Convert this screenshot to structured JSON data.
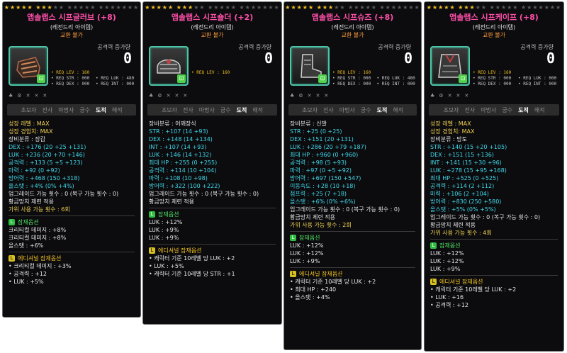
{
  "cards": [
    {
      "title": "앱솔랩스 시프글러브 (+8)",
      "rarity": "(레전드리 아이템)",
      "trade": "교환 불가",
      "stars_filled": 8,
      "stars_total": 22,
      "atk_label": "공격력 증가량",
      "atk_value": "0",
      "req_lev": "• REQ LEV : 160",
      "req_str": "• REQ STR : 000",
      "req_luk": "• REQ LUK : 480",
      "req_dex": "• REQ DEX : 000",
      "req_int": "• REQ INT : 000",
      "jobs": [
        "초보자",
        "전사",
        "마법사",
        "궁수",
        "도적",
        "해적"
      ],
      "active_job": "도적",
      "lines": [
        {
          "t": "성장 레벨 : MAX",
          "cls": "y"
        },
        {
          "t": "성장 경험치: MAX",
          "cls": "y"
        },
        {
          "t": "장비분류 : 장갑",
          "cls": "w"
        },
        {
          "t": "DEX : +176 (20 +25 +131)",
          "cls": "c"
        },
        {
          "t": "LUK : +236 (20 +70 +146)",
          "cls": "c"
        },
        {
          "t": "공격력 : +133 (5 +5 +123)",
          "cls": "c"
        },
        {
          "t": "마력 : +92 (0 +92)",
          "cls": "c"
        },
        {
          "t": "방어력 : +468 (150 +318)",
          "cls": "c"
        },
        {
          "t": "올스탯 : +4% (0% +4%)",
          "cls": "c"
        },
        {
          "t": "업그레이드 가능 횟수 : 0 (복구 가능 횟수 : 0)",
          "cls": "w"
        },
        {
          "t": "황금망치 제련 적용",
          "cls": "w"
        },
        {
          "t": "가위 사용 가능 횟수 : 6회",
          "cls": "y"
        }
      ],
      "potential_title": "잠재옵션",
      "potential": [
        "크리티컬 데미지 : +8%",
        "크리티컬 데미지 : +8%",
        "올스탯 : +6%"
      ],
      "additional_title": "에디셔널 잠재옵션",
      "additional": [
        "• 크리티컬 데미지 : +3%",
        "• 공격력 : +12",
        "• LUK : +5%"
      ]
    },
    {
      "title": "앱솔랩스 시프숄더 (+2)",
      "rarity": "(레전드리 아이템)",
      "trade": "교환 불가",
      "stars_filled": 8,
      "stars_total": 22,
      "atk_label": "공격력 증가량",
      "atk_value": "0",
      "req_lev": "• REQ LEV : 160",
      "req_str": "",
      "req_luk": "",
      "req_dex": "",
      "req_int": "",
      "jobs": [
        "초보자",
        "전사",
        "마법사",
        "궁수",
        "도적",
        "해적"
      ],
      "active_job": "도적",
      "lines": [
        {
          "t": "장비분류 : 어깨장식",
          "cls": "w"
        },
        {
          "t": "STR : +107 (14 +93)",
          "cls": "c"
        },
        {
          "t": "DEX : +148 (14 +134)",
          "cls": "c"
        },
        {
          "t": "INT : +107 (14 +93)",
          "cls": "c"
        },
        {
          "t": "LUK : +146 (14 +132)",
          "cls": "c"
        },
        {
          "t": "최대 HP : +255 (0 +255)",
          "cls": "c"
        },
        {
          "t": "공격력 : +114 (10 +104)",
          "cls": "c"
        },
        {
          "t": "마력 : +108 (10 +98)",
          "cls": "c"
        },
        {
          "t": "방어력 : +322 (100 +222)",
          "cls": "c"
        },
        {
          "t": "업그레이드 가능 횟수 : 0 (복구 가능 횟수 : 0)",
          "cls": "w"
        },
        {
          "t": "황금망치 제련 적용",
          "cls": "w"
        }
      ],
      "potential_title": "잠재옵션",
      "potential": [
        "LUK : +12%",
        "LUK : +9%",
        "LUK : +9%"
      ],
      "additional_title": "에디셔널 잠재옵션",
      "additional": [
        "• 캐릭터 기준 10레벨 당 LUK : +2",
        "• LUK : +5%",
        "• 캐릭터 기준 10레벨 당 STR : +1"
      ]
    },
    {
      "title": "앱솔랩스 시프슈즈 (+8)",
      "rarity": "(레전드리 아이템)",
      "trade": "교환 불가",
      "stars_filled": 8,
      "stars_total": 22,
      "atk_label": "공격력 증가량",
      "atk_value": "0",
      "req_lev": "• REQ LEV : 160",
      "req_str": "• REQ STR : 000",
      "req_luk": "• REQ LUK : 480",
      "req_dex": "• REQ DEX : 000",
      "req_int": "• REQ INT : 000",
      "jobs": [
        "초보자",
        "전사",
        "마법사",
        "궁수",
        "도적",
        "해적"
      ],
      "active_job": "도적",
      "lines": [
        {
          "t": "장비분류 : 신발",
          "cls": "w"
        },
        {
          "t": "STR : +25 (0 +25)",
          "cls": "c"
        },
        {
          "t": "DEX : +151 (20 +131)",
          "cls": "c"
        },
        {
          "t": "LUK : +286 (20 +79 +187)",
          "cls": "c"
        },
        {
          "t": "최대 HP : +960 (0 +960)",
          "cls": "c"
        },
        {
          "t": "공격력 : +98 (5 +93)",
          "cls": "c"
        },
        {
          "t": "마력 : +97 (0 +5 +92)",
          "cls": "c"
        },
        {
          "t": "방어력 : +697 (150 +547)",
          "cls": "c"
        },
        {
          "t": "이동속도 : +28 (10 +18)",
          "cls": "c"
        },
        {
          "t": "점프력 : +25 (7 +18)",
          "cls": "c"
        },
        {
          "t": "올스탯 : +6% (0% +6%)",
          "cls": "c"
        },
        {
          "t": "업그레이드 가능 횟수 : 0 (복구 가능 횟수 : 0)",
          "cls": "w"
        },
        {
          "t": "황금망치 제련 적용",
          "cls": "w"
        },
        {
          "t": "가위 사용 가능 횟수 : 2회",
          "cls": "y"
        }
      ],
      "potential_title": "잠재옵션",
      "potential": [
        "LUK : +12%",
        "LUK : +12%",
        "LUK : +9%"
      ],
      "additional_title": "에디셔널 잠재옵션",
      "additional": [
        "• 캐릭터 기준 10레벨 당 LUK : +2",
        "• 최대 HP : +240",
        "• 올스탯 : +4%"
      ]
    },
    {
      "title": "앱솔랩스 시프케이프 (+8)",
      "rarity": "(레전드리 아이템)",
      "trade": "교환 불가",
      "stars_filled": 8,
      "stars_total": 22,
      "atk_label": "공격력 증가량",
      "atk_value": "0",
      "req_lev": "• REQ LEV : 160",
      "req_str": "• REQ STR : 000",
      "req_luk": "• REQ LUK : 000",
      "req_dex": "• REQ DEX : 000",
      "req_int": "• REQ INT : 000",
      "jobs": [
        "초보자",
        "전사",
        "마법사",
        "궁수",
        "도적",
        "해적"
      ],
      "active_job": "도적",
      "lines": [
        {
          "t": "성장 레벨 : MAX",
          "cls": "y"
        },
        {
          "t": "성장 경험치: MAX",
          "cls": "y"
        },
        {
          "t": "장비분류 : 망토",
          "cls": "w"
        },
        {
          "t": "STR : +140 (15 +20 +105)",
          "cls": "c"
        },
        {
          "t": "DEX : +151 (15 +136)",
          "cls": "c"
        },
        {
          "t": "INT : +141 (15 +30 +96)",
          "cls": "c"
        },
        {
          "t": "LUK : +278 (15 +95 +168)",
          "cls": "c"
        },
        {
          "t": "최대 HP : +525 (0 +525)",
          "cls": "c"
        },
        {
          "t": "공격력 : +114 (2 +112)",
          "cls": "c"
        },
        {
          "t": "마력 : +106 (2 +104)",
          "cls": "c"
        },
        {
          "t": "방어력 : +830 (250 +580)",
          "cls": "c"
        },
        {
          "t": "올스탯 : +5% (0% +5%)",
          "cls": "c"
        },
        {
          "t": "업그레이드 가능 횟수 : 0 (복구 가능 횟수 : 0)",
          "cls": "w"
        },
        {
          "t": "황금망치 제련 적용",
          "cls": "w"
        },
        {
          "t": "가위 사용 가능 횟수 : 4회",
          "cls": "y"
        }
      ],
      "potential_title": "잠재옵션",
      "potential": [
        "LUK : +12%",
        "LUK : +12%",
        "LUK : +9%"
      ],
      "additional_title": "에디셔널 잠재옵션",
      "additional": [
        "• 캐릭터 기준 10레벨 당 LUK : +2",
        "• LUK : +16",
        "• 공격력 : +12"
      ]
    }
  ]
}
